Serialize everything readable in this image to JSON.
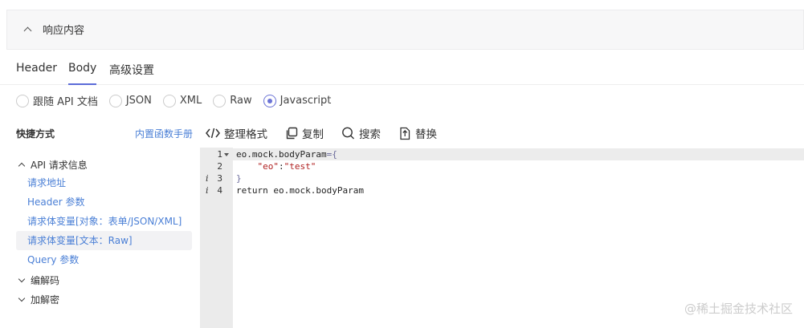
{
  "collapse": {
    "title": "响应内容"
  },
  "tabs": [
    {
      "label": "Header"
    },
    {
      "label": "Body"
    },
    {
      "label": "高级设置"
    }
  ],
  "radios": [
    {
      "label": "跟随 API 文档"
    },
    {
      "label": "JSON"
    },
    {
      "label": "XML"
    },
    {
      "label": "Raw"
    },
    {
      "label": "Javascript"
    }
  ],
  "sidebar": {
    "title": "快捷方式",
    "manual_link": "内置函数手册",
    "groups": [
      {
        "label": "API 请求信息"
      },
      {
        "label": "编解码"
      },
      {
        "label": "加解密"
      }
    ],
    "items": [
      {
        "label": "请求地址"
      },
      {
        "label": "Header 参数"
      },
      {
        "label": "请求体变量[对象：表单/JSON/XML]"
      },
      {
        "label": "请求体变量[文本：Raw]"
      },
      {
        "label": "Query 参数"
      }
    ]
  },
  "toolbar": {
    "format_label": "整理格式",
    "copy_label": "复制",
    "search_label": "搜索",
    "replace_label": "替换"
  },
  "editor": {
    "line_numbers": [
      "1",
      "2",
      "3",
      "4"
    ],
    "info_marker": "i",
    "l1_obj": "eo.mock.bodyParam",
    "l1_rest": "={",
    "l2_key": "\"eo\"",
    "l2_colon": ":",
    "l2_val": "\"test\"",
    "l3": "}",
    "l4": "return eo.mock.bodyParam"
  },
  "watermark": "@稀土掘金技术社区"
}
